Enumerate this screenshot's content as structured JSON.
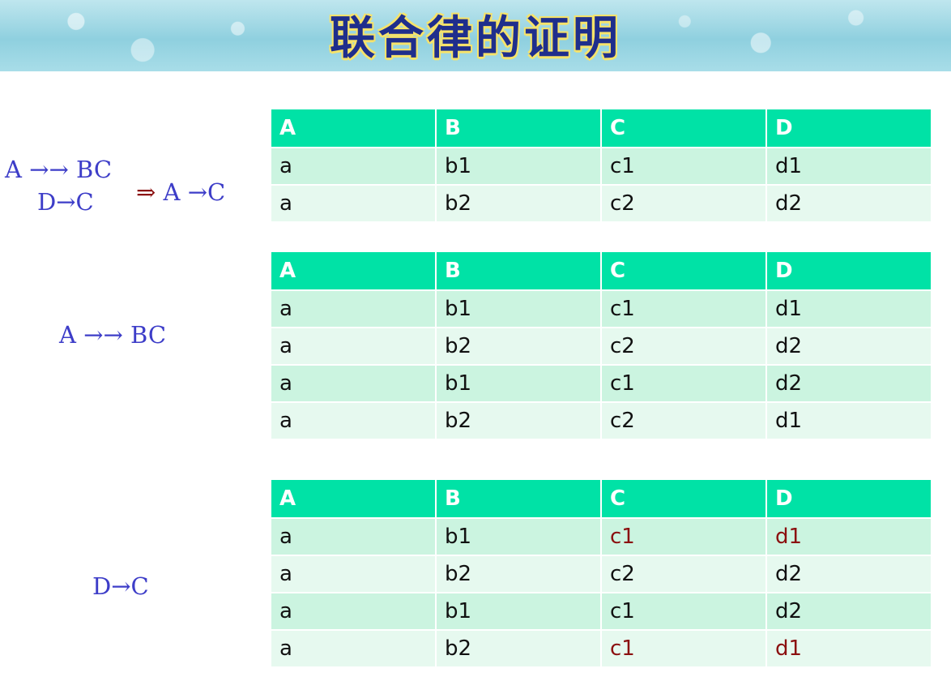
{
  "title": "联合律的证明",
  "formulas": {
    "f1_line1": "A →→ BC",
    "f1_line2": "D→C",
    "f1_implies": "⇒",
    "f1_result": "A →C",
    "f2": "A →→ BC",
    "f3": "D→C"
  },
  "colors": {
    "header_bg": "#00e2a6",
    "row_odd": "#cbf4e0",
    "row_even": "#e6f9ef",
    "highlight_text": "#8b1010",
    "formula_text": "#3d3dc8"
  },
  "tables": [
    {
      "headers": [
        "A",
        "B",
        "C",
        "D"
      ],
      "rows": [
        [
          "a",
          "b1",
          "c1",
          "d1"
        ],
        [
          "a",
          "b2",
          "c2",
          "d2"
        ]
      ]
    },
    {
      "headers": [
        "A",
        "B",
        "C",
        "D"
      ],
      "rows": [
        [
          "a",
          "b1",
          "c1",
          "d1"
        ],
        [
          "a",
          "b2",
          "c2",
          "d2"
        ],
        [
          "a",
          "b1",
          "c1",
          "d2"
        ],
        [
          "a",
          "b2",
          "c2",
          "d1"
        ]
      ]
    },
    {
      "headers": [
        "A",
        "B",
        "C",
        "D"
      ],
      "rows": [
        [
          "a",
          "b1",
          "c1",
          "d1"
        ],
        [
          "a",
          "b2",
          "c2",
          "d2"
        ],
        [
          "a",
          "b1",
          "c1",
          "d2"
        ],
        [
          "a",
          "b2",
          "c1",
          "d1"
        ]
      ],
      "highlighted_rows": [
        0,
        3
      ]
    }
  ]
}
